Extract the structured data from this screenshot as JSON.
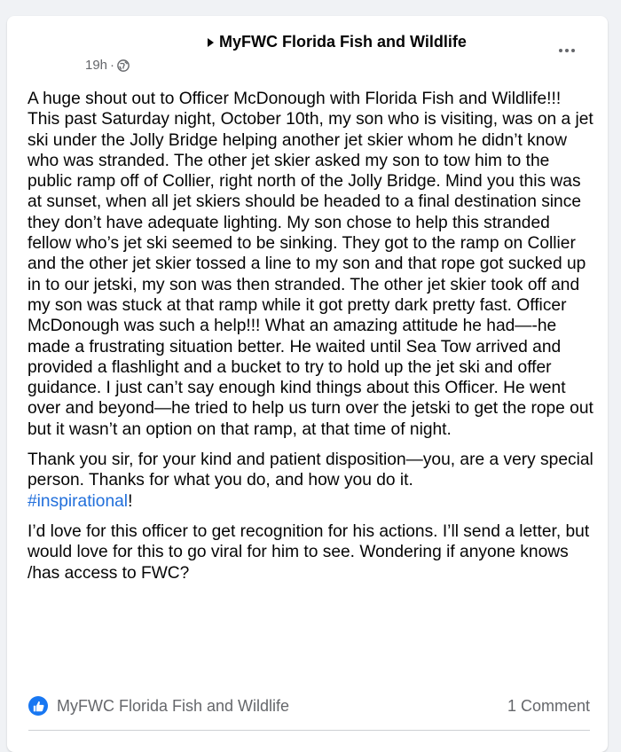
{
  "post": {
    "page_name": "MyFWC Florida Fish and Wildlife",
    "time": "19h",
    "separator": "·",
    "privacy_icon": "globe-icon",
    "more_icon": "more-options-icon",
    "paragraphs": [
      "A huge shout out to Officer McDonough with Florida Fish and Wildlife!!! This past Saturday night, October 10th, my son who is visiting, was on a jet ski under the Jolly Bridge helping another jet skier whom he didn’t know who was stranded. The other jet skier asked my son to tow him to the public ramp off of Collier, right north of the Jolly Bridge. Mind you this was at sunset, when all jet skiers should be headed to a final destination since they don’t have adequate lighting. My son chose to help this stranded fellow who’s jet ski seemed to be sinking. They got to the ramp on Collier and the other jet skier tossed a line to my son and that rope got sucked up in to our jetski, my son was then stranded. The other jet skier took off and my son was stuck at that ramp while it got pretty dark pretty fast. Officer McDonough was such a help!!! What an amazing attitude he had—-he made a frustrating situation better. He waited until Sea Tow arrived and provided a flashlight and a bucket to try to hold up the jet ski and offer guidance. I just can’t say enough kind things about this Officer. He went over and beyond—he tried to help us turn over the jetski to get the rope out but it wasn’t an option on that ramp, at that time of night.",
      "Thank you sir, for your kind and patient disposition—you, are a very special person. Thanks for what you do, and how you do it.",
      "I’d love for this officer to get recognition for his actions. I’ll send a letter, but would love for this to go viral for him to see. Wondering if anyone knows /has access to FWC?"
    ],
    "hashtag": "#inspirational",
    "hashtag_suffix": "!"
  },
  "footer": {
    "reaction_icon": "like-icon",
    "reactors": "MyFWC Florida Fish and Wildlife",
    "comment_count": "1 Comment"
  },
  "colors": {
    "background": "#f0f2f5",
    "card": "#ffffff",
    "text": "#050505",
    "secondary_text": "#65676b",
    "link": "#216fdb",
    "like_blue": "#1877f2"
  }
}
